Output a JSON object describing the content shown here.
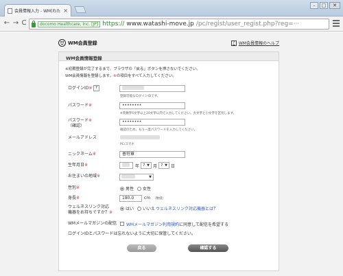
{
  "browser": {
    "tab_title": "会員情報入力 - WM(わた",
    "tab_close": "×",
    "win_min": "–",
    "win_max": "□",
    "win_close": "✕",
    "back": "←",
    "forward": "→",
    "reload": "C",
    "ev_label": "docomo Healthcare, Inc. [JP]",
    "url_scheme": "https://",
    "url_host": "www.watashi-move.jp",
    "url_path": "/pc/regist/user_regist.php?reg=···"
  },
  "header": {
    "logo_text": "WM会員登録",
    "help_icon": "?",
    "help_link": "WM会員情報のヘルプ"
  },
  "panel": {
    "title": "WM会員情報登録",
    "intro1": "※初期登録が完了するまで、ブラウザの「戻る」ボタンを押さないでください。",
    "intro2_prefix": "WM会員情報を登録します。",
    "intro2_req": "※",
    "intro2_suffix": "の項目をすべて入力してください。"
  },
  "form": {
    "login_id_label": "ログインID",
    "login_id_help": "?",
    "login_id_hint": "登録可能なログインIDです。",
    "password_label": "パスワード",
    "password_value": "••••••••",
    "password_hint": "※英数字6文字以上20文字以内で入力してください。大文字と小文字を区別します。",
    "password_confirm_label1": "パスワード",
    "password_confirm_label2": "（確認）",
    "password_confirm_value": "••••••••",
    "password_confirm_hint": "確認のため、もう一度パスワードを入力してください。",
    "email_label": "メールアドレス",
    "email_type": "PC/スマホ",
    "nickname_label": "ニックネーム",
    "nickname_value": "普符章",
    "birthday_label": "生年月日",
    "birthday_year_unit": "年",
    "birthday_month": "7",
    "birthday_month_unit": "月",
    "birthday_day": "7",
    "birthday_day_unit": "日",
    "region_label": "お住まいの地域",
    "gender_label": "性別",
    "gender_male": "男性",
    "gender_female": "女性",
    "height_label": "身長",
    "height_value": "180.0",
    "height_unit": "cm",
    "height_note": "（数値）",
    "wellness_label1": "ウェルネスリンク対応",
    "wellness_label2": "機器をお持ちですか？",
    "wellness_yes": "はい",
    "wellness_no": "いいえ",
    "wellness_link": "ウェルネスリンク対応機器とは？",
    "magazine_label": "WMメールマガジンの配信",
    "magazine_link": "WMメールマガジン利用規約",
    "magazine_suffix": "に同意して配信を希望する",
    "notice": "ログインIDとパスワードは忘れないように大切に保管してください。",
    "req_mark": "※",
    "chev": "▼"
  },
  "buttons": {
    "back": "戻る",
    "confirm": "確認する"
  }
}
